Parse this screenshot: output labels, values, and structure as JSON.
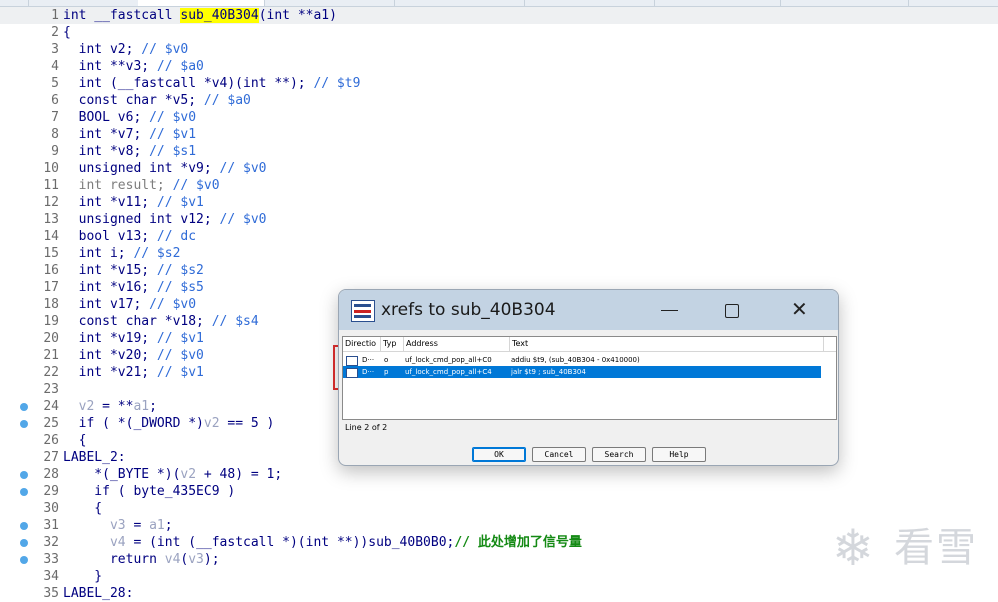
{
  "editor": {
    "highlight_color": "#ffff00",
    "breakpoint_color": "#52a7e8",
    "lines": [
      {
        "n": "1",
        "dot": false,
        "segs": [
          [
            "k",
            "int __fastcall "
          ],
          [
            "hl",
            "sub_40B304"
          ],
          [
            "k",
            "(int **a1)"
          ]
        ]
      },
      {
        "n": "2",
        "dot": false,
        "segs": [
          [
            "k",
            "{"
          ]
        ]
      },
      {
        "n": "3",
        "dot": false,
        "segs": [
          [
            "k",
            "  int v2; "
          ],
          [
            "c",
            "// $v0"
          ]
        ]
      },
      {
        "n": "4",
        "dot": false,
        "segs": [
          [
            "k",
            "  int **v3; "
          ],
          [
            "c",
            "// $a0"
          ]
        ]
      },
      {
        "n": "5",
        "dot": false,
        "segs": [
          [
            "k",
            "  int (__fastcall *v4)(int **); "
          ],
          [
            "c",
            "// $t9"
          ]
        ]
      },
      {
        "n": "6",
        "dot": false,
        "segs": [
          [
            "k",
            "  const char *v5; "
          ],
          [
            "c",
            "// $a0"
          ]
        ]
      },
      {
        "n": "7",
        "dot": false,
        "segs": [
          [
            "k",
            "  BOOL v6; "
          ],
          [
            "c",
            "// $v0"
          ]
        ]
      },
      {
        "n": "8",
        "dot": false,
        "segs": [
          [
            "k",
            "  int *v7; "
          ],
          [
            "c",
            "// $v1"
          ]
        ]
      },
      {
        "n": "9",
        "dot": false,
        "segs": [
          [
            "k",
            "  int *v8; "
          ],
          [
            "c",
            "// $s1"
          ]
        ]
      },
      {
        "n": "10",
        "dot": false,
        "segs": [
          [
            "k",
            "  unsigned int *v9; "
          ],
          [
            "c",
            "// $v0"
          ]
        ]
      },
      {
        "n": "11",
        "dot": false,
        "segs": [
          [
            "g",
            "  int result; "
          ],
          [
            "c",
            "// $v0"
          ]
        ]
      },
      {
        "n": "12",
        "dot": false,
        "segs": [
          [
            "k",
            "  int *v11; "
          ],
          [
            "c",
            "// $v1"
          ]
        ]
      },
      {
        "n": "13",
        "dot": false,
        "segs": [
          [
            "k",
            "  unsigned int v12; "
          ],
          [
            "c",
            "// $v0"
          ]
        ]
      },
      {
        "n": "14",
        "dot": false,
        "segs": [
          [
            "k",
            "  bool v13; "
          ],
          [
            "c",
            "// dc"
          ]
        ]
      },
      {
        "n": "15",
        "dot": false,
        "segs": [
          [
            "k",
            "  int i; "
          ],
          [
            "c",
            "// $s2"
          ]
        ]
      },
      {
        "n": "16",
        "dot": false,
        "segs": [
          [
            "k",
            "  int *v15; "
          ],
          [
            "c",
            "// $s2"
          ]
        ]
      },
      {
        "n": "17",
        "dot": false,
        "segs": [
          [
            "k",
            "  int *v16; "
          ],
          [
            "c",
            "// $s5"
          ]
        ]
      },
      {
        "n": "18",
        "dot": false,
        "segs": [
          [
            "k",
            "  int v17; "
          ],
          [
            "c",
            "// $v0"
          ]
        ]
      },
      {
        "n": "19",
        "dot": false,
        "segs": [
          [
            "k",
            "  const char *v18; "
          ],
          [
            "c",
            "// $s4"
          ]
        ]
      },
      {
        "n": "20",
        "dot": false,
        "segs": [
          [
            "k",
            "  int *v19; "
          ],
          [
            "c",
            "// $v1"
          ]
        ]
      },
      {
        "n": "21",
        "dot": false,
        "segs": [
          [
            "k",
            "  int *v20; "
          ],
          [
            "c",
            "// $v0"
          ]
        ]
      },
      {
        "n": "22",
        "dot": false,
        "segs": [
          [
            "k",
            "  int *v21; "
          ],
          [
            "c",
            "// $v1"
          ]
        ]
      },
      {
        "n": "23",
        "dot": false,
        "segs": []
      },
      {
        "n": "24",
        "dot": true,
        "segs": [
          [
            "v",
            "  v2"
          ],
          [
            "k",
            " = **"
          ],
          [
            "v",
            "a1"
          ],
          [
            "k",
            ";"
          ]
        ]
      },
      {
        "n": "25",
        "dot": true,
        "segs": [
          [
            "k",
            "  if ( *(_DWORD *)"
          ],
          [
            "v",
            "v2"
          ],
          [
            "k",
            " == 5 )"
          ]
        ]
      },
      {
        "n": "26",
        "dot": false,
        "segs": [
          [
            "k",
            "  {"
          ]
        ]
      },
      {
        "n": "27",
        "dot": false,
        "segs": [
          [
            "k",
            "LABEL_2:"
          ]
        ]
      },
      {
        "n": "28",
        "dot": true,
        "segs": [
          [
            "k",
            "    *(_BYTE *)("
          ],
          [
            "v",
            "v2"
          ],
          [
            "k",
            " + 48) = 1;"
          ]
        ]
      },
      {
        "n": "29",
        "dot": true,
        "segs": [
          [
            "k",
            "    if ( byte_435EC9 )"
          ]
        ]
      },
      {
        "n": "30",
        "dot": false,
        "segs": [
          [
            "k",
            "    {"
          ]
        ]
      },
      {
        "n": "31",
        "dot": true,
        "segs": [
          [
            "k",
            "      "
          ],
          [
            "v",
            "v3"
          ],
          [
            "k",
            " = "
          ],
          [
            "v",
            "a1"
          ],
          [
            "k",
            ";"
          ]
        ]
      },
      {
        "n": "32",
        "dot": true,
        "segs": [
          [
            "k",
            "      "
          ],
          [
            "v",
            "v4"
          ],
          [
            "k",
            " = (int (__fastcall *)(int **))sub_40B0B0;"
          ],
          [
            "cg",
            "// 此处增加了信号量"
          ]
        ]
      },
      {
        "n": "33",
        "dot": true,
        "segs": [
          [
            "k",
            "      return "
          ],
          [
            "v",
            "v4"
          ],
          [
            "k",
            "("
          ],
          [
            "v",
            "v3"
          ],
          [
            "k",
            ");"
          ]
        ]
      },
      {
        "n": "34",
        "dot": false,
        "segs": [
          [
            "k",
            "    }"
          ]
        ]
      },
      {
        "n": "35",
        "dot": false,
        "segs": [
          [
            "k",
            "LABEL_28:"
          ]
        ]
      }
    ]
  },
  "dialog": {
    "title": "xrefs to sub_40B304",
    "columns": {
      "direction": "Directio",
      "type": "Typ",
      "address": "Address",
      "text": "Text"
    },
    "rows": [
      {
        "direction": "D···",
        "type": "o",
        "address": "uf_lock_cmd_pop_all+C0",
        "text": "addiu   $t9, (sub_40B304 - 0x410000)",
        "selected": false
      },
      {
        "direction": "D···",
        "type": "p",
        "address": "uf_lock_cmd_pop_all+C4",
        "text": "jalr    $t9 ; sub_40B304",
        "selected": true
      }
    ],
    "status": "Line 2 of 2",
    "buttons": {
      "ok": "OK",
      "cancel": "Cancel",
      "search": "Search",
      "help": "Help"
    },
    "selection_color": "#0078d7",
    "annotation_color": "#e03030"
  },
  "watermark": {
    "symbol": "❄",
    "text": "看雪"
  }
}
